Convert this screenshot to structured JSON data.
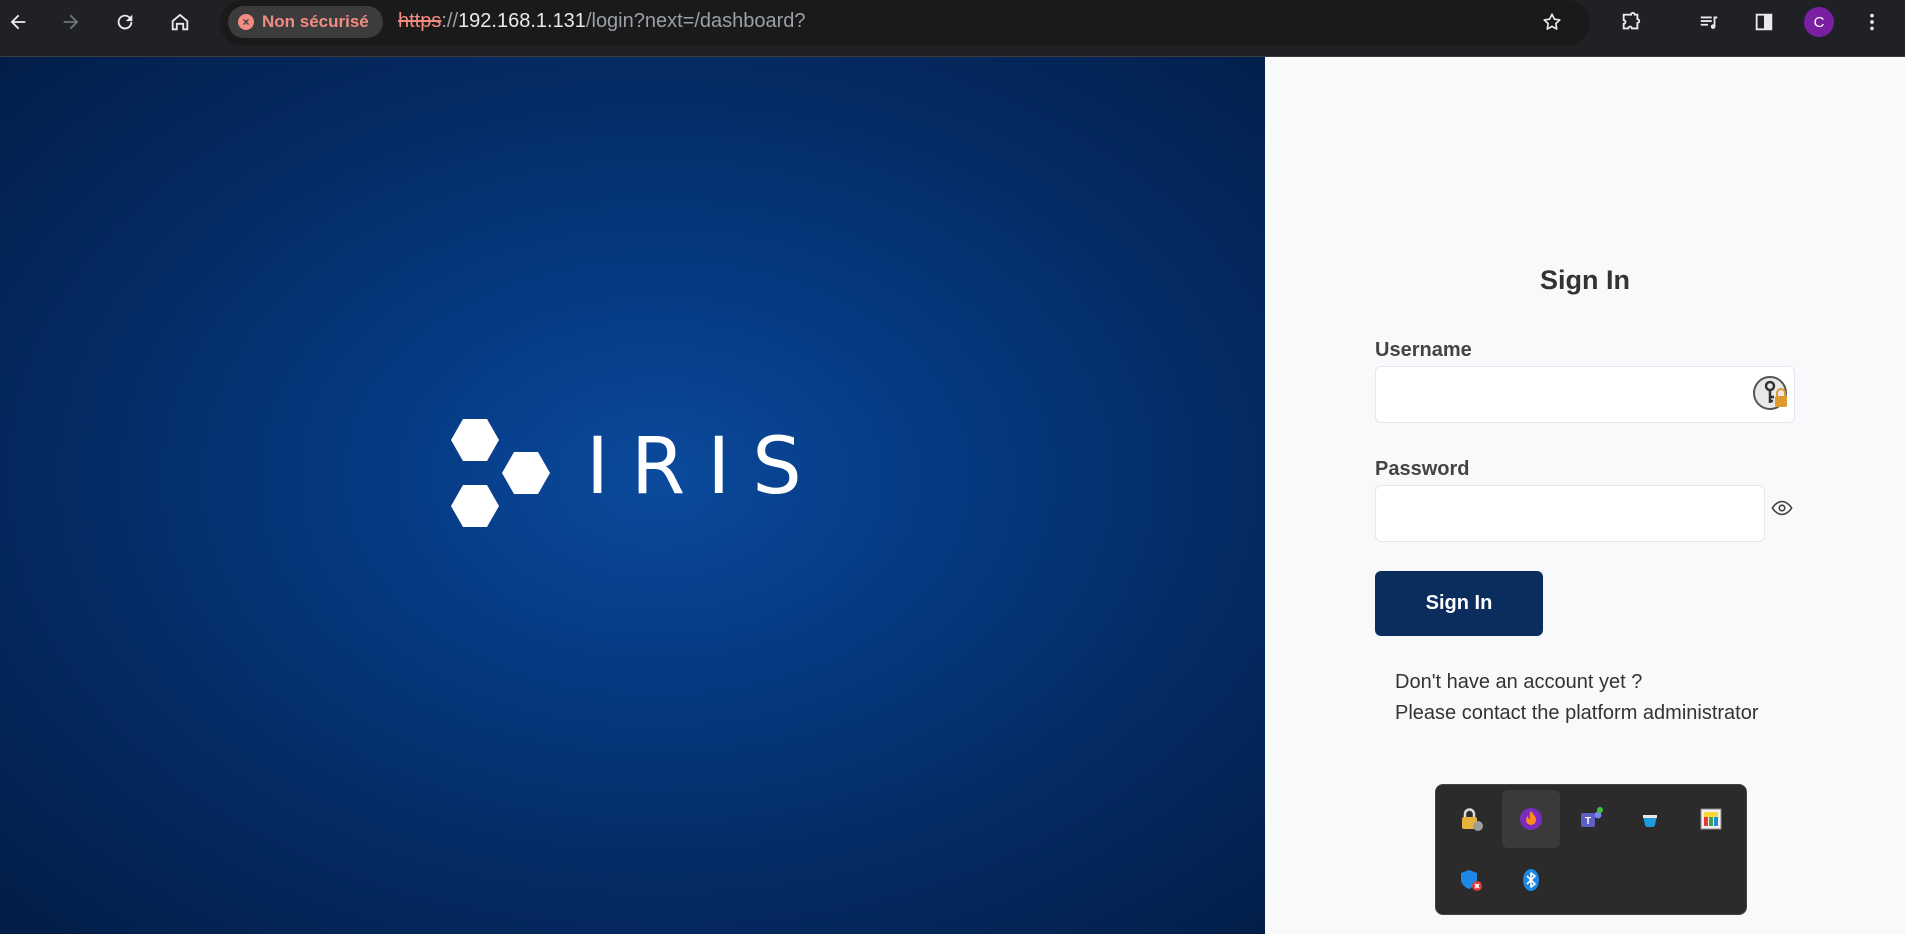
{
  "browser": {
    "security_chip": "Non sécurisé",
    "url": {
      "scheme": "https",
      "sep": "://",
      "host": "192.168.1.131",
      "path": "/login?next=/dashboard?"
    },
    "profile_initial": "C",
    "icons": [
      "back-icon",
      "forward-icon",
      "reload-icon",
      "home-icon",
      "bookmark-star-icon",
      "extensions-icon",
      "media-queue-icon",
      "side-panel-icon",
      "menu-dots-icon"
    ]
  },
  "hero": {
    "logo_text": "IRIS"
  },
  "login": {
    "title": "Sign In",
    "username_label": "Username",
    "username_value": "",
    "password_label": "Password",
    "password_value": "",
    "submit_label": "Sign In",
    "note_line1": "Don't have an account yet ?",
    "note_line2": "Please contact the platform administrator"
  },
  "tray": {
    "items": [
      "keepass-lock-icon",
      "flame-app-icon",
      "teams-icon",
      "cup-app-icon",
      "color-grid-app-icon",
      "defender-alert-icon",
      "bluetooth-icon"
    ]
  },
  "colors": {
    "hero_bg": "#063a82",
    "button_bg": "#0a2d5e",
    "panel_bg": "#f8f9fb",
    "insecure_red": "#f28b82",
    "avatar": "#7b1fa2"
  }
}
